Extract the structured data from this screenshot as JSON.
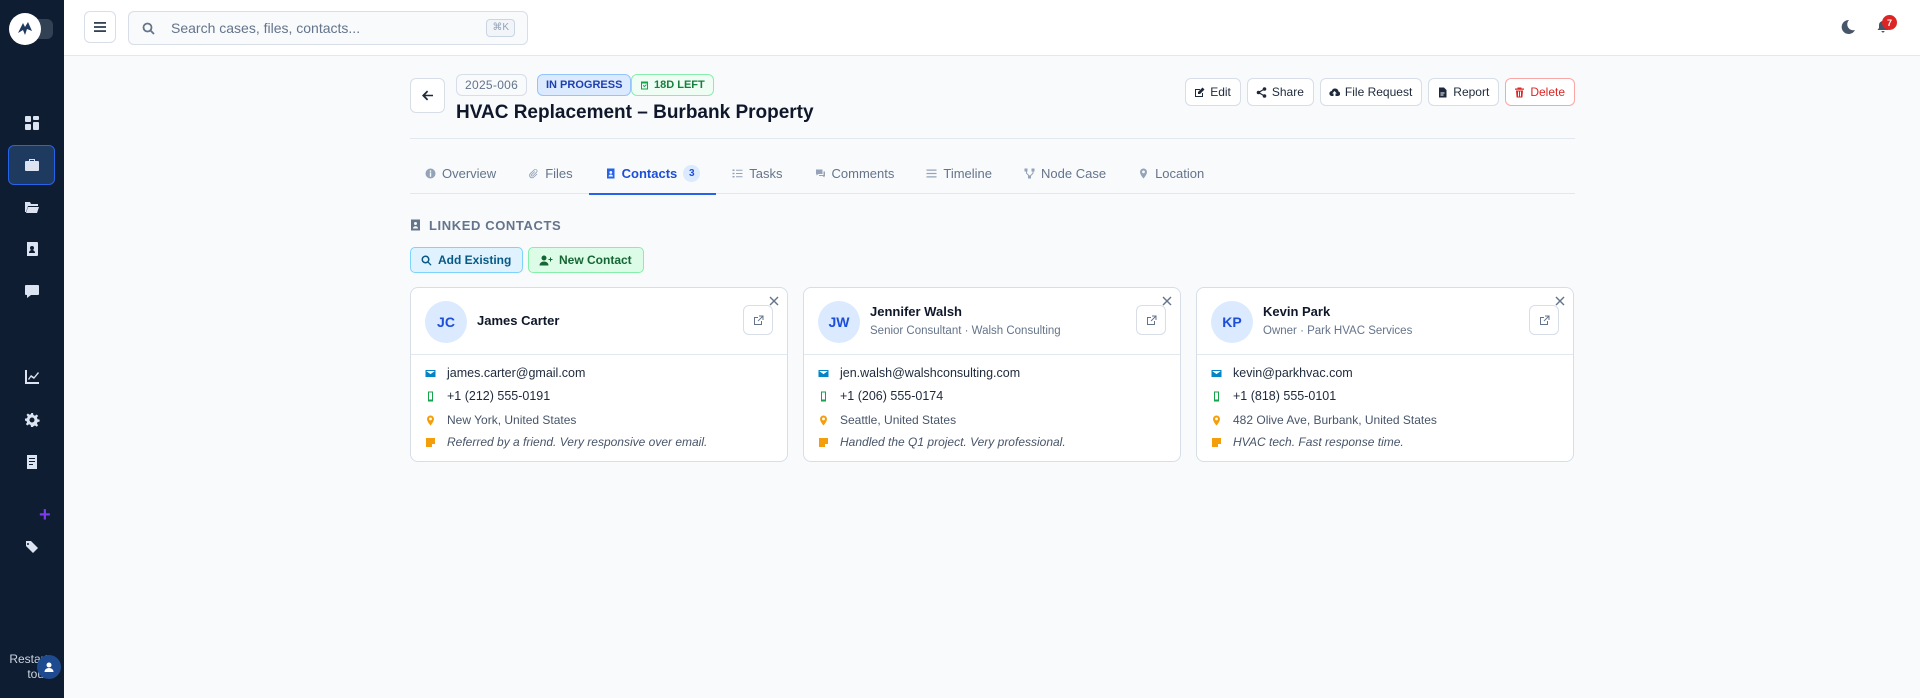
{
  "topbar": {
    "search_placeholder": "Search cases, files, contacts...",
    "search_shortcut": "⌘K",
    "notification_count": "7"
  },
  "sidebar": {
    "restart_label": "Restart tour"
  },
  "case": {
    "number": "2025-006",
    "status": "IN PROGRESS",
    "time_left": "18D LEFT",
    "title": "HVAC Replacement – Burbank Property",
    "status_color": "#1e40af",
    "time_color": "#15803d"
  },
  "actions": {
    "edit": "Edit",
    "share": "Share",
    "file_request": "File Request",
    "report": "Report",
    "delete": "Delete"
  },
  "tabs": [
    {
      "label": "Overview",
      "icon": "info-circle-icon"
    },
    {
      "label": "Files",
      "icon": "paperclip-icon"
    },
    {
      "label": "Contacts",
      "icon": "address-book-icon",
      "count": "3",
      "active": true
    },
    {
      "label": "Tasks",
      "icon": "list-check-icon"
    },
    {
      "label": "Comments",
      "icon": "comments-icon"
    },
    {
      "label": "Timeline",
      "icon": "timeline-icon"
    },
    {
      "label": "Node Case",
      "icon": "sitemap-icon"
    },
    {
      "label": "Location",
      "icon": "map-pin-icon"
    }
  ],
  "contacts_section": {
    "title": "LINKED CONTACTS",
    "add_existing": "Add Existing",
    "new_contact": "New Contact"
  },
  "contacts": [
    {
      "initials": "JC",
      "name": "James Carter",
      "subtitle": "",
      "email": "james.carter@gmail.com",
      "phone": "+1 (212) 555-0191",
      "location": "New York, United States",
      "note": "Referred by a friend. Very responsive over email."
    },
    {
      "initials": "JW",
      "name": "Jennifer Walsh",
      "subtitle": "Senior Consultant · Walsh Consulting",
      "email": "jen.walsh@walshconsulting.com",
      "phone": "+1 (206) 555-0174",
      "location": "Seattle, United States",
      "note": "Handled the Q1 project. Very professional."
    },
    {
      "initials": "KP",
      "name": "Kevin Park",
      "subtitle": "Owner · Park HVAC Services",
      "email": "kevin@parkhvac.com",
      "phone": "+1 (818) 555-0101",
      "location": "482 Olive Ave, Burbank, United States",
      "note": "HVAC tech. Fast response time."
    }
  ],
  "colors": {
    "sidebar_bg": "#0f1d33",
    "accent": "#2563eb",
    "email_icon": "#0284c7",
    "phone_icon": "#16a34a",
    "location_icon": "#f59e0b",
    "note_icon": "#f59e0b",
    "delete": "#dc2626"
  }
}
